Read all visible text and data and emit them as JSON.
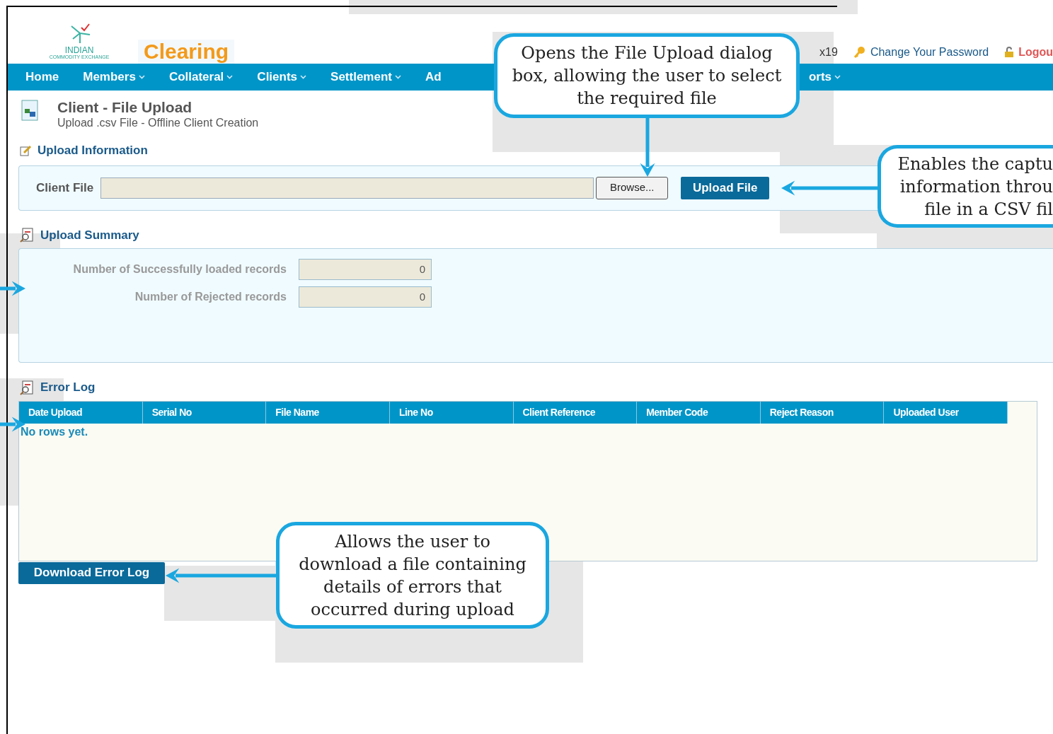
{
  "header": {
    "logo_text": "INDIAN",
    "logo_sub": "COMMODITY EXCHANGE",
    "app_title": "Clearing",
    "user": "x19",
    "links": [
      {
        "label": "Change Your Password",
        "kind": "password"
      },
      {
        "label": "Logou",
        "kind": "logout"
      }
    ]
  },
  "nav": [
    {
      "label": "Home",
      "dropdown": false
    },
    {
      "label": "Members",
      "dropdown": true
    },
    {
      "label": "Collateral",
      "dropdown": true
    },
    {
      "label": "Clients",
      "dropdown": true
    },
    {
      "label": "Settlement",
      "dropdown": true
    },
    {
      "label": "Ad",
      "dropdown": false
    },
    {
      "label": "orts",
      "dropdown": true
    }
  ],
  "page": {
    "title": "Client - File Upload",
    "subtitle": "Upload .csv File - Offline Client Creation"
  },
  "upload_information": {
    "heading": "Upload Information",
    "field_label": "Client File",
    "browse": "Browse...",
    "upload": "Upload File"
  },
  "upload_summary": {
    "heading": "Upload Summary",
    "rows": [
      {
        "label": "Number of Successfully loaded records",
        "value": "0"
      },
      {
        "label": "Number of Rejected records",
        "value": "0"
      }
    ]
  },
  "error_log": {
    "heading": "Error Log",
    "columns": [
      "Date Upload",
      "Serial No",
      "File Name",
      "Line No",
      "Client Reference",
      "Member Code",
      "Reject Reason",
      "Uploaded User"
    ],
    "empty": "No rows yet.",
    "download": "Download Error Log"
  },
  "callouts": [
    {
      "kind": "top",
      "lines": [
        "Opens the File Upload dialog box, allowing the user to select the required file"
      ]
    },
    {
      "kind": "right",
      "lines": [
        "Enables the captu",
        "information throu",
        "file in a CSV fil"
      ]
    },
    {
      "kind": "bottom",
      "lines": [
        "Allows the user to download a file containing details of errors that occurred during upload"
      ]
    }
  ]
}
